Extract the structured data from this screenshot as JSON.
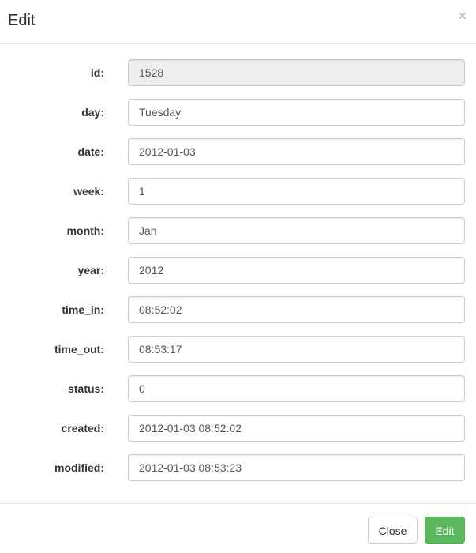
{
  "modal": {
    "title": "Edit",
    "close_icon": "close-icon",
    "close_glyph": "×"
  },
  "fields": [
    {
      "key": "id",
      "label": "id:",
      "value": "1528",
      "readonly": true
    },
    {
      "key": "day",
      "label": "day:",
      "value": "Tuesday",
      "readonly": false
    },
    {
      "key": "date",
      "label": "date:",
      "value": "2012-01-03",
      "readonly": false
    },
    {
      "key": "week",
      "label": "week:",
      "value": "1",
      "readonly": false
    },
    {
      "key": "month",
      "label": "month:",
      "value": "Jan",
      "readonly": false
    },
    {
      "key": "year",
      "label": "year:",
      "value": "2012",
      "readonly": false
    },
    {
      "key": "time_in",
      "label": "time_in:",
      "value": "08:52:02",
      "readonly": false
    },
    {
      "key": "time_out",
      "label": "time_out:",
      "value": "08:53:17",
      "readonly": false
    },
    {
      "key": "status",
      "label": "status:",
      "value": "0",
      "readonly": false
    },
    {
      "key": "created",
      "label": "created:",
      "value": "2012-01-03 08:52:02",
      "readonly": false
    },
    {
      "key": "modified",
      "label": "modified:",
      "value": "2012-01-03 08:53:23",
      "readonly": false
    }
  ],
  "footer": {
    "close_label": "Close",
    "edit_label": "Edit"
  },
  "colors": {
    "success": "#5cb85c",
    "readonly_bg": "#eeeeee",
    "border": "#cccccc"
  }
}
